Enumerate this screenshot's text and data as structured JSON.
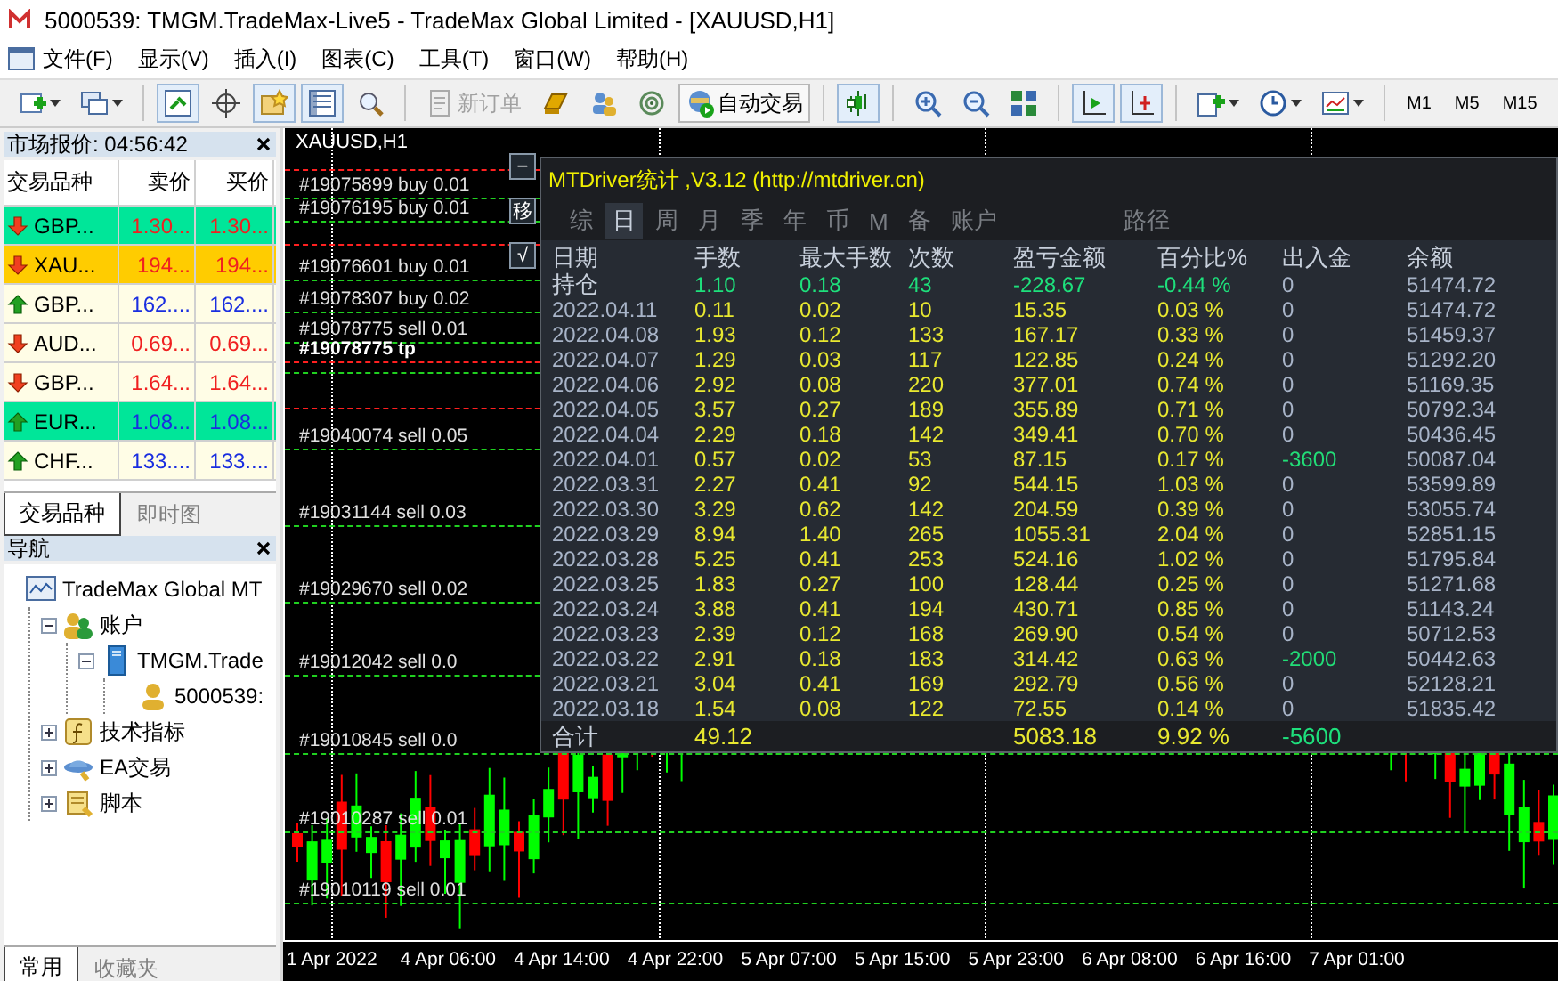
{
  "window": {
    "title": "5000539: TMGM.TradeMax-Live5 - TradeMax Global Limited - [XAUUSD,H1]"
  },
  "menu": [
    "文件(F)",
    "显示(V)",
    "插入(I)",
    "图表(C)",
    "工具(T)",
    "窗口(W)",
    "帮助(H)"
  ],
  "toolbar": [
    {
      "kind": "icon",
      "pressed": false,
      "dropdown": true
    },
    {
      "kind": "icon",
      "pressed": false,
      "dropdown": true
    },
    {
      "kind": "separator"
    },
    {
      "kind": "icon",
      "pressed": true,
      "dropdown": false
    },
    {
      "kind": "icon",
      "pressed": false,
      "dropdown": false
    },
    {
      "kind": "icon",
      "pressed": true,
      "dropdown": false
    },
    {
      "kind": "icon",
      "pressed": true,
      "dropdown": false
    },
    {
      "kind": "icon",
      "pressed": false,
      "dropdown": false
    },
    {
      "kind": "separator"
    },
    {
      "kind": "text-button",
      "label": "新订单",
      "disabled": true
    },
    {
      "kind": "icon",
      "pressed": false,
      "dropdown": false
    },
    {
      "kind": "icon",
      "pressed": false,
      "dropdown": false
    },
    {
      "kind": "icon",
      "pressed": false,
      "dropdown": false
    },
    {
      "kind": "text-button",
      "label": "自动交易",
      "disabled": false
    },
    {
      "kind": "separator"
    },
    {
      "kind": "icon",
      "pressed": true,
      "dropdown": false
    },
    {
      "kind": "separator"
    },
    {
      "kind": "icon",
      "pressed": false,
      "dropdown": false
    },
    {
      "kind": "icon",
      "pressed": false,
      "dropdown": false
    },
    {
      "kind": "icon",
      "pressed": false,
      "dropdown": false
    },
    {
      "kind": "separator"
    },
    {
      "kind": "icon",
      "pressed": true,
      "dropdown": false
    },
    {
      "kind": "icon",
      "pressed": true,
      "dropdown": false
    },
    {
      "kind": "separator"
    },
    {
      "kind": "icon",
      "pressed": false,
      "dropdown": true
    },
    {
      "kind": "icon",
      "pressed": false,
      "dropdown": true
    },
    {
      "kind": "icon",
      "pressed": false,
      "dropdown": true
    },
    {
      "kind": "separator"
    },
    {
      "kind": "timeframe",
      "label": "M1"
    },
    {
      "kind": "timeframe",
      "label": "M5"
    },
    {
      "kind": "timeframe",
      "label": "M15"
    }
  ],
  "market_watch": {
    "title": "市场报价: 04:56:42",
    "columns": [
      "交易品种",
      "卖价",
      "买价"
    ],
    "rows": [
      {
        "symbol": "GBP...",
        "bid": "1.30...",
        "ask": "1.30...",
        "kind": "down",
        "color": "#00e699"
      },
      {
        "symbol": "XAU...",
        "bid": "194...",
        "ask": "194...",
        "kind": "down",
        "color": "#ffcc00"
      },
      {
        "symbol": "GBP...",
        "bid": "162....",
        "ask": "162....",
        "kind": "up",
        "color": "#fffde6"
      },
      {
        "symbol": "AUD...",
        "bid": "0.69...",
        "ask": "0.69...",
        "kind": "down",
        "color": "#fffde6"
      },
      {
        "symbol": "GBP...",
        "bid": "1.64...",
        "ask": "1.64...",
        "kind": "down",
        "color": "#fffde6"
      },
      {
        "symbol": "EUR...",
        "bid": "1.08...",
        "ask": "1.08...",
        "kind": "up",
        "color": "#00e699"
      },
      {
        "symbol": "CHF...",
        "bid": "133....",
        "ask": "133....",
        "kind": "up",
        "color": "#fffde6"
      }
    ],
    "tabs": [
      {
        "label": "交易品种",
        "selected": true
      },
      {
        "label": "即时图",
        "selected": false
      }
    ]
  },
  "navigator": {
    "title": "导航",
    "tree": [
      {
        "label": "TradeMax Global MT",
        "children": [
          {
            "label": "账户",
            "expanded": true,
            "children": [
              {
                "label": "TMGM.Trade",
                "expanded": true,
                "children": [
                  {
                    "label": "5000539:"
                  }
                ]
              }
            ]
          },
          {
            "label": "技术指标",
            "expanded": false
          },
          {
            "label": "EA交易",
            "expanded": false
          },
          {
            "label": "脚本",
            "expanded": false
          }
        ]
      }
    ],
    "tabs": [
      {
        "label": "常用",
        "selected": true
      },
      {
        "label": "收藏夹",
        "selected": false
      }
    ]
  },
  "chart": {
    "title": "XAUUSD,H1",
    "order_lines": [
      {
        "kind": "tp"
      },
      {
        "kind": "order",
        "label": "#19075899 buy 0.01"
      },
      {
        "kind": "order",
        "label": "#19076195 buy 0.01"
      },
      {
        "kind": "tp"
      },
      {
        "kind": "order",
        "label": "#19076601 buy 0.01"
      },
      {
        "kind": "order",
        "label": "#19078307 buy 0.02"
      },
      {
        "kind": "order",
        "label": "#19078775 sell 0.01"
      },
      {
        "kind": "tp",
        "label": "#19078775 tp"
      },
      {
        "kind": "order"
      },
      {
        "kind": "tp"
      },
      {
        "kind": "order",
        "label": "#19040074 sell 0.05"
      },
      {
        "kind": "order",
        "label": "#19031144 sell 0.03"
      },
      {
        "kind": "order",
        "label": "#19029670 sell 0.02"
      },
      {
        "kind": "order",
        "label": "#19012042 sell 0.0"
      },
      {
        "kind": "order",
        "label": "#19010845 sell 0.0"
      },
      {
        "kind": "order",
        "label": "#19010287 sell 0.01"
      },
      {
        "kind": "order",
        "label": "#19010119 sell 0.01"
      }
    ],
    "side_buttons": [
      "−",
      "移",
      "√"
    ],
    "time_labels": [
      "1 Apr 2022",
      "4 Apr 06:00",
      "4 Apr 14:00",
      "4 Apr 22:00",
      "5 Apr 07:00",
      "5 Apr 15:00",
      "5 Apr 23:00",
      "6 Apr 08:00",
      "6 Apr 16:00",
      "7 Apr 01:00"
    ]
  },
  "stats_panel": {
    "title": "MTDriver统计 ,V3.12 (http://mtdriver.cn)",
    "tabs": [
      {
        "label": "综",
        "selected": false
      },
      {
        "label": "日",
        "selected": true
      },
      {
        "label": "周",
        "selected": false
      },
      {
        "label": "月",
        "selected": false
      },
      {
        "label": "季",
        "selected": false
      },
      {
        "label": "年",
        "selected": false
      },
      {
        "label": "币",
        "selected": false
      },
      {
        "label": "M",
        "selected": false
      },
      {
        "label": "备",
        "selected": false
      },
      {
        "label": "账户",
        "selected": false
      },
      {
        "label": "路径",
        "selected": false
      }
    ],
    "columns": [
      "日期",
      "手数",
      "最大手数",
      "次数",
      "盈亏金额",
      "百分比%",
      "出入金",
      "余额"
    ],
    "rows": [
      {
        "kind": "position",
        "date": "持仓",
        "lots": "1.10",
        "max_lots": "0.18",
        "count": "43",
        "profit": "-228.67",
        "percent": "-0.44 %",
        "flow": {
          "text": "0",
          "color": "#a8b4c8"
        },
        "balance": "51474.72"
      },
      {
        "kind": "day",
        "date": "2022.04.11",
        "lots": "0.11",
        "max_lots": "0.02",
        "count": "10",
        "profit": "15.35",
        "percent": "0.03 %",
        "flow": {
          "text": "0",
          "color": "#a8b4c8"
        },
        "balance": "51474.72"
      },
      {
        "kind": "day",
        "date": "2022.04.08",
        "lots": "1.93",
        "max_lots": "0.12",
        "count": "133",
        "profit": "167.17",
        "percent": "0.33 %",
        "flow": {
          "text": "0",
          "color": "#a8b4c8"
        },
        "balance": "51459.37"
      },
      {
        "kind": "day",
        "date": "2022.04.07",
        "lots": "1.29",
        "max_lots": "0.03",
        "count": "117",
        "profit": "122.85",
        "percent": "0.24 %",
        "flow": {
          "text": "0",
          "color": "#a8b4c8"
        },
        "balance": "51292.20"
      },
      {
        "kind": "day",
        "date": "2022.04.06",
        "lots": "2.92",
        "max_lots": "0.08",
        "count": "220",
        "profit": "377.01",
        "percent": "0.74 %",
        "flow": {
          "text": "0",
          "color": "#a8b4c8"
        },
        "balance": "51169.35"
      },
      {
        "kind": "day",
        "date": "2022.04.05",
        "lots": "3.57",
        "max_lots": "0.27",
        "count": "189",
        "profit": "355.89",
        "percent": "0.71 %",
        "flow": {
          "text": "0",
          "color": "#a8b4c8"
        },
        "balance": "50792.34"
      },
      {
        "kind": "day",
        "date": "2022.04.04",
        "lots": "2.29",
        "max_lots": "0.18",
        "count": "142",
        "profit": "349.41",
        "percent": "0.70 %",
        "flow": {
          "text": "0",
          "color": "#a8b4c8"
        },
        "balance": "50436.45"
      },
      {
        "kind": "day",
        "date": "2022.04.01",
        "lots": "0.57",
        "max_lots": "0.02",
        "count": "53",
        "profit": "87.15",
        "percent": "0.17 %",
        "flow": {
          "text": "-3600",
          "color": "#22dd77"
        },
        "balance": "50087.04"
      },
      {
        "kind": "day",
        "date": "2022.03.31",
        "lots": "2.27",
        "max_lots": "0.41",
        "count": "92",
        "profit": "544.15",
        "percent": "1.03 %",
        "flow": {
          "text": "0",
          "color": "#a8b4c8"
        },
        "balance": "53599.89"
      },
      {
        "kind": "day",
        "date": "2022.03.30",
        "lots": "3.29",
        "max_lots": "0.62",
        "count": "142",
        "profit": "204.59",
        "percent": "0.39 %",
        "flow": {
          "text": "0",
          "color": "#a8b4c8"
        },
        "balance": "53055.74"
      },
      {
        "kind": "day",
        "date": "2022.03.29",
        "lots": "8.94",
        "max_lots": "1.40",
        "count": "265",
        "profit": "1055.31",
        "percent": "2.04 %",
        "flow": {
          "text": "0",
          "color": "#a8b4c8"
        },
        "balance": "52851.15"
      },
      {
        "kind": "day",
        "date": "2022.03.28",
        "lots": "5.25",
        "max_lots": "0.41",
        "count": "253",
        "profit": "524.16",
        "percent": "1.02 %",
        "flow": {
          "text": "0",
          "color": "#a8b4c8"
        },
        "balance": "51795.84"
      },
      {
        "kind": "day",
        "date": "2022.03.25",
        "lots": "1.83",
        "max_lots": "0.27",
        "count": "100",
        "profit": "128.44",
        "percent": "0.25 %",
        "flow": {
          "text": "0",
          "color": "#a8b4c8"
        },
        "balance": "51271.68"
      },
      {
        "kind": "day",
        "date": "2022.03.24",
        "lots": "3.88",
        "max_lots": "0.41",
        "count": "194",
        "profit": "430.71",
        "percent": "0.85 %",
        "flow": {
          "text": "0",
          "color": "#a8b4c8"
        },
        "balance": "51143.24"
      },
      {
        "kind": "day",
        "date": "2022.03.23",
        "lots": "2.39",
        "max_lots": "0.12",
        "count": "168",
        "profit": "269.90",
        "percent": "0.54 %",
        "flow": {
          "text": "0",
          "color": "#a8b4c8"
        },
        "balance": "50712.53"
      },
      {
        "kind": "day",
        "date": "2022.03.22",
        "lots": "2.91",
        "max_lots": "0.18",
        "count": "183",
        "profit": "314.42",
        "percent": "0.63 %",
        "flow": {
          "text": "-2000",
          "color": "#22dd77"
        },
        "balance": "50442.63"
      },
      {
        "kind": "day",
        "date": "2022.03.21",
        "lots": "3.04",
        "max_lots": "0.41",
        "count": "169",
        "profit": "292.79",
        "percent": "0.56 %",
        "flow": {
          "text": "0",
          "color": "#a8b4c8"
        },
        "balance": "52128.21"
      },
      {
        "kind": "day",
        "date": "2022.03.18",
        "lots": "1.54",
        "max_lots": "0.08",
        "count": "122",
        "profit": "72.55",
        "percent": "0.14 %",
        "flow": {
          "text": "0",
          "color": "#a8b4c8"
        },
        "balance": "51835.42"
      }
    ],
    "total": {
      "label": "合计",
      "lots": "49.12",
      "profit": "5083.18",
      "percent": "9.92 %",
      "flow": "-5600"
    }
  }
}
